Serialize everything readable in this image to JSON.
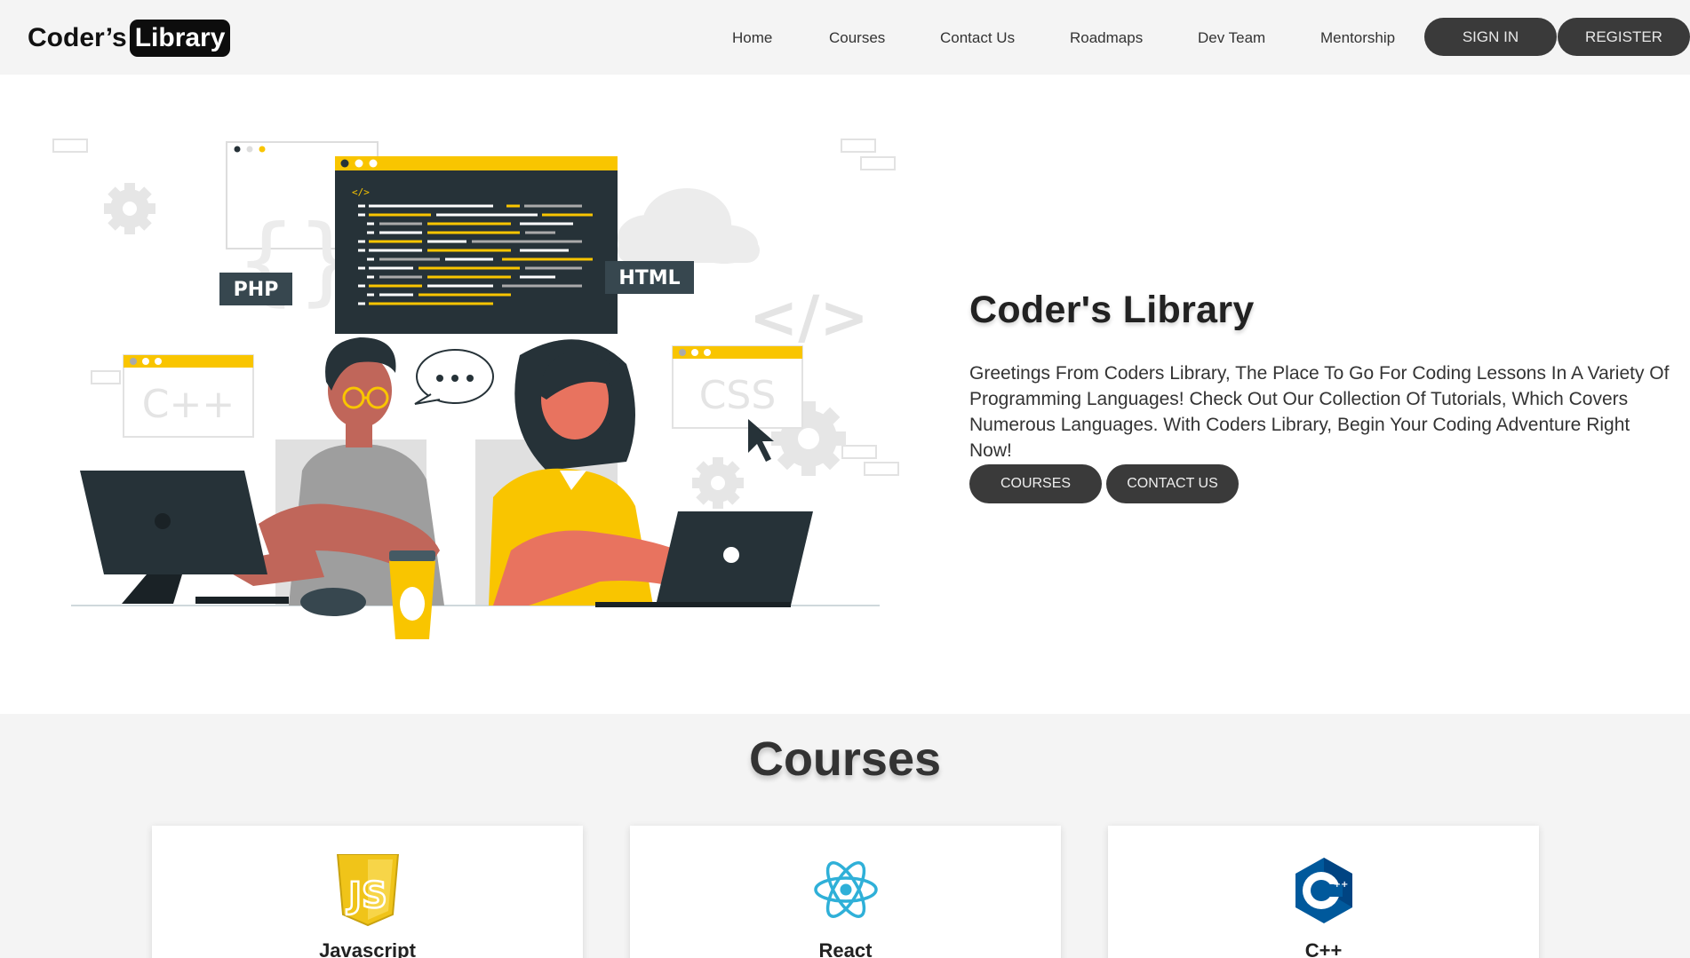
{
  "nav": {
    "logo_part1": "Coder’s",
    "logo_part2": "Library",
    "links": [
      "Home",
      "Courses",
      "Contact Us",
      "Roadmaps",
      "Dev Team",
      "Mentorship"
    ],
    "sign_in": "SIGN IN",
    "register": "REGISTER"
  },
  "hero": {
    "title": "Coder's Library",
    "description": "Greetings From Coders Library, The Place To Go For Coding Lessons In A Variety Of Programming Languages! Check Out Our Collection Of Tutorials, Which Covers Numerous Languages. With Coders Library, Begin Your Coding Adventure Right Now!",
    "courses_button": "COURSES",
    "contact_button": "CONTACT US",
    "illustration_labels": {
      "php": "PHP",
      "html": "HTML",
      "cpp": "C++",
      "css": "CSS",
      "code_tag": "</>"
    }
  },
  "courses": {
    "title": "Courses",
    "cards": [
      {
        "name": "Javascript",
        "icon": "js-logo-icon"
      },
      {
        "name": "React",
        "icon": "react-logo-icon"
      },
      {
        "name": "C++",
        "icon": "cpp-logo-icon"
      }
    ]
  },
  "colors": {
    "accent_yellow": "#f9c500",
    "dark_slate": "#263238",
    "skin": "#e8735f",
    "pill_bg": "#3a3a3a",
    "react_blue": "#2fb0d8",
    "cpp_blue": "#00599c"
  }
}
